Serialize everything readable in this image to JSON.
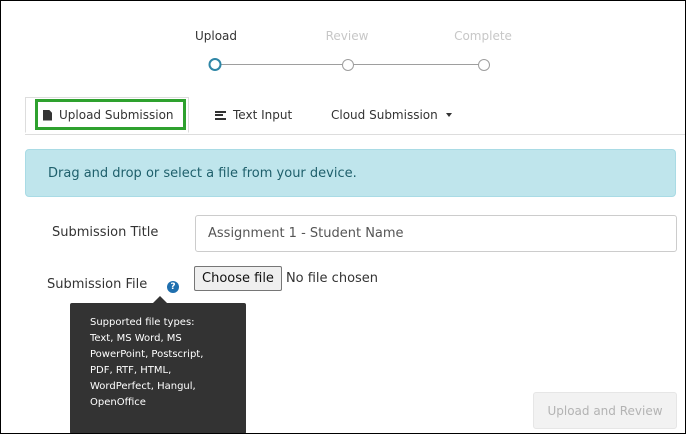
{
  "stepper": {
    "steps": [
      {
        "label": "Upload",
        "state": "active"
      },
      {
        "label": "Review",
        "state": "inactive"
      },
      {
        "label": "Complete",
        "state": "inactive"
      }
    ]
  },
  "tabs": {
    "upload_label": "Upload Submission",
    "text_label": "Text Input",
    "cloud_label": "Cloud Submission",
    "upload_icon": "file-icon",
    "text_icon": "lines-icon",
    "cloud_icon": "caret-down-icon"
  },
  "alert": {
    "message": "Drag and drop or select a file from your device."
  },
  "form": {
    "title_label": "Submission Title",
    "title_value": "Assignment 1 - Student Name",
    "file_label": "Submission File",
    "choose_button": "Choose file",
    "no_file_text": "No file chosen",
    "help_glyph": "?"
  },
  "tooltip": {
    "lines": [
      "Supported file types:",
      "Text, MS Word, MS",
      "PowerPoint, Postscript,",
      "PDF, RTF, HTML,",
      "WordPerfect, Hangul,",
      "OpenOffice"
    ]
  },
  "actions": {
    "submit_label": "Upload and Review",
    "submit_enabled": false
  },
  "colors": {
    "accent": "#2f86a6",
    "highlight": "#2ea12e",
    "alert_bg": "#bfe5ec",
    "tooltip_bg": "#333333",
    "help_icon": "#1f6fae"
  }
}
